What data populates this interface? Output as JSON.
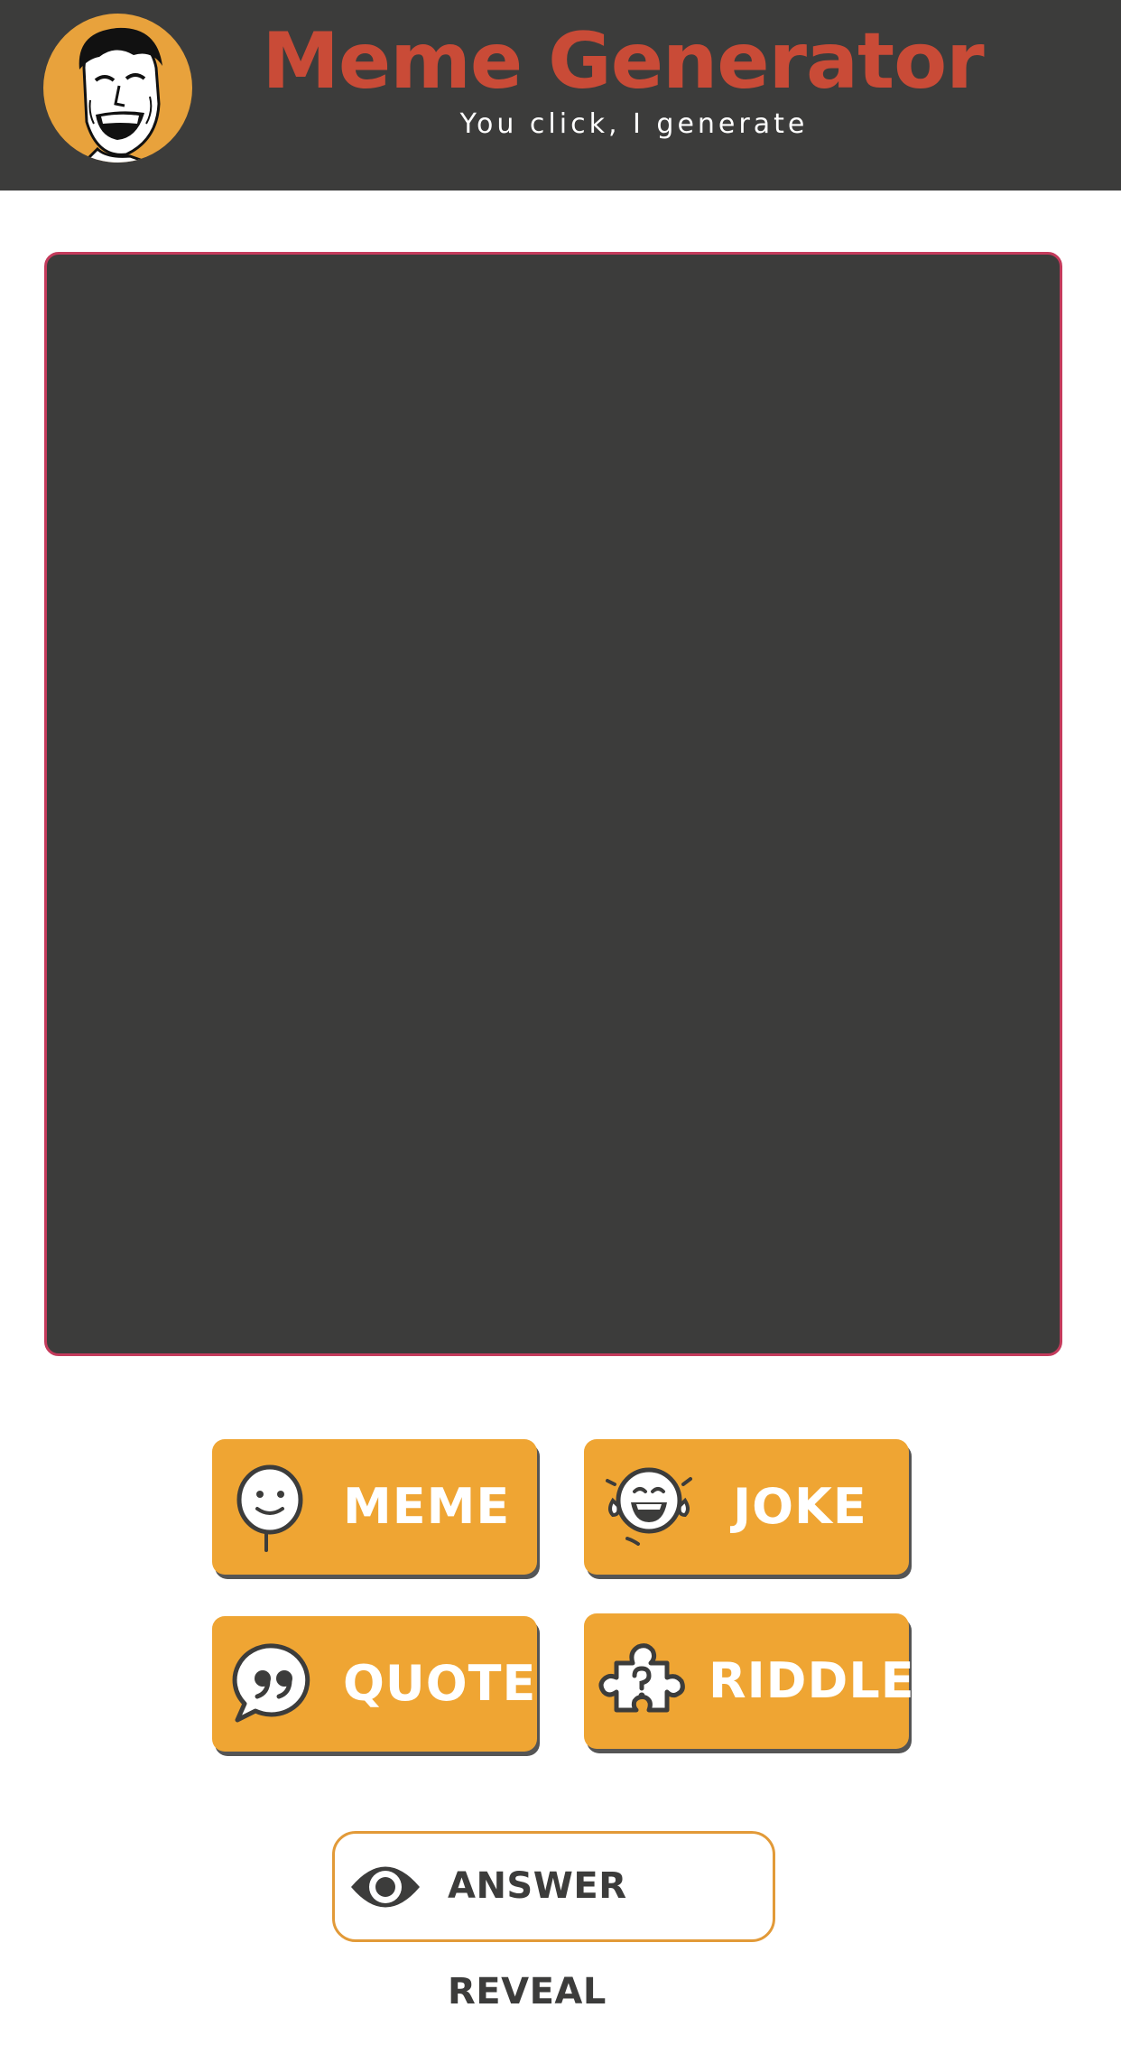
{
  "header": {
    "title": "Meme Generator",
    "subtitle": "You click, I generate",
    "logo_icon": "laughing-meme-face-icon"
  },
  "buttons": [
    {
      "label": "MEME",
      "icon": "meme-face-icon"
    },
    {
      "label": "JOKE",
      "icon": "laughing-tears-icon"
    },
    {
      "label": "QUOTE",
      "icon": "quote-bubble-icon"
    },
    {
      "label": "RIDDLE",
      "icon": "puzzle-question-icon"
    }
  ],
  "reveal": {
    "label": "ANSWER REVEAL",
    "icon": "eye-icon"
  },
  "colors": {
    "header_bg": "#3c3c3b",
    "title": "#c94b37",
    "accent": "#efa533",
    "canvas_border": "#c43b5c",
    "canvas_bg": "#3c3c3b"
  }
}
